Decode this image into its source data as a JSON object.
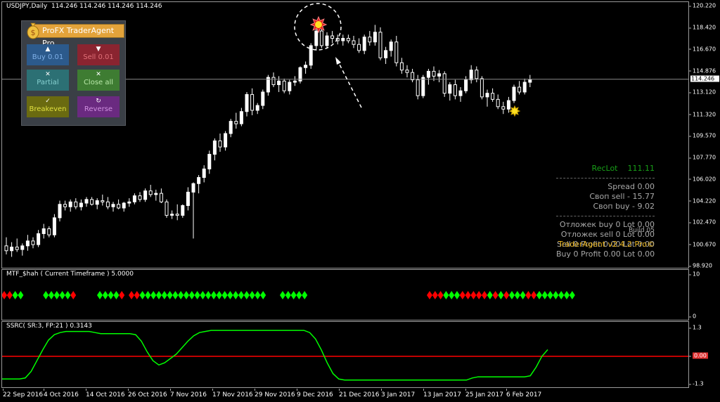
{
  "chart_header": {
    "symbol": "USDJPY,Daily",
    "ohlc": "114.246 114.246 114.246 114.246"
  },
  "price_axis": [
    "120.220",
    "118.420",
    "116.670",
    "114.876",
    "113.120",
    "111.320",
    "109.570",
    "107.770",
    "106.020",
    "104.220",
    "102.470",
    "100.670",
    "98.920"
  ],
  "current_price": "114.246",
  "trade_panel": {
    "title": "ProFX TraderAgent Pro",
    "buttons": {
      "buy": "Buy 0.01",
      "sell": "Sell 0.01",
      "partial": "Partial",
      "close_all": "Close all",
      "breakeven": "Breakeven",
      "reverse": "Reverse"
    },
    "colors": {
      "brand": "#e3a33a",
      "panel": "#3a3f46"
    }
  },
  "info_panel": {
    "reclot_label": "RecLot",
    "reclot_value": "111.11",
    "spread": "Spread   0.00",
    "swap_sell": "Своп sell  - 15.77",
    "swap_buy": "Своп buy  - 9.02",
    "pending_buy": "Отложек buy 0   Lot 0.00",
    "pending_sell": "Отложек sell 0   Lot 0.00",
    "build": "Build 05",
    "version": "TraderAgent v2.4.2 Pro©",
    "sell_summary": "Sell 0  Profit 0.00  Lot 0.00",
    "buy_summary": "Buy 0  Profit 0.00  Lot 0.00"
  },
  "mtf_indicator": {
    "title": "MTF_$hah ( Current Timeframe )  5.0000",
    "scale_top": "10",
    "scale_bottom": "0",
    "colors": {
      "up": "#00ff00",
      "down": "#ff0000"
    }
  },
  "ssrc_indicator": {
    "title": "SSRC( SR:3, FP:21 ) 0.3143",
    "scale_top": "1.3",
    "scale_zero": "0.00",
    "scale_bottom": "-1.3",
    "colors": {
      "line": "#00ff00",
      "zero": "#ff0000"
    }
  },
  "time_axis": [
    "22 Sep 2016",
    "4 Oct 2016",
    "14 Oct 2016",
    "26 Oct 2016",
    "7 Nov 2016",
    "17 Nov 2016",
    "29 Nov 2016",
    "9 Dec 2016",
    "21 Dec 2016",
    "3 Jan 2017",
    "13 Jan 2017",
    "25 Jan 2017",
    "6 Feb 2017"
  ],
  "chart_data": [
    {
      "type": "candlestick",
      "title": "USDJPY,Daily",
      "ylim": [
        98.92,
        120.22
      ],
      "candles": [
        [
          100.6,
          101.3,
          99.9,
          100.2
        ],
        [
          100.2,
          100.9,
          99.7,
          100.5
        ],
        [
          100.5,
          101.2,
          100.1,
          100.3
        ],
        [
          100.3,
          100.8,
          99.8,
          100.6
        ],
        [
          100.6,
          101.5,
          100.2,
          101.0
        ],
        [
          101.0,
          101.3,
          100.4,
          100.7
        ],
        [
          100.7,
          101.9,
          100.5,
          101.6
        ],
        [
          101.6,
          102.4,
          101.2,
          102.0
        ],
        [
          102.0,
          102.2,
          101.3,
          101.5
        ],
        [
          101.5,
          103.2,
          101.3,
          102.9
        ],
        [
          102.9,
          104.3,
          102.6,
          104.0
        ],
        [
          104.0,
          104.3,
          103.5,
          103.8
        ],
        [
          103.8,
          104.4,
          103.4,
          104.2
        ],
        [
          104.2,
          104.5,
          103.6,
          103.8
        ],
        [
          103.8,
          104.4,
          103.5,
          104.1
        ],
        [
          104.1,
          104.6,
          103.8,
          104.4
        ],
        [
          104.4,
          104.6,
          103.9,
          104.0
        ],
        [
          104.0,
          104.5,
          103.6,
          104.3
        ],
        [
          104.3,
          104.8,
          103.9,
          104.2
        ],
        [
          104.2,
          104.6,
          103.6,
          103.8
        ],
        [
          103.8,
          104.2,
          103.4,
          104.0
        ],
        [
          104.0,
          104.4,
          103.6,
          103.7
        ],
        [
          103.7,
          104.2,
          103.4,
          104.1
        ],
        [
          104.1,
          104.5,
          103.8,
          104.2
        ],
        [
          104.2,
          104.9,
          104.0,
          104.7
        ],
        [
          104.7,
          105.0,
          104.2,
          104.4
        ],
        [
          104.4,
          105.3,
          104.2,
          105.1
        ],
        [
          105.1,
          105.6,
          104.6,
          104.8
        ],
        [
          104.8,
          105.2,
          104.3,
          104.9
        ],
        [
          104.9,
          105.3,
          104.1,
          104.2
        ],
        [
          104.2,
          104.4,
          102.9,
          103.1
        ],
        [
          103.1,
          103.5,
          102.8,
          103.2
        ],
        [
          103.2,
          104.0,
          102.7,
          103.1
        ],
        [
          103.1,
          104.0,
          102.9,
          103.9
        ],
        [
          103.9,
          105.4,
          103.5,
          105.0
        ],
        [
          105.0,
          105.8,
          101.2,
          105.7
        ],
        [
          105.7,
          106.4,
          104.9,
          106.2
        ],
        [
          106.2,
          107.2,
          105.8,
          106.9
        ],
        [
          106.9,
          108.4,
          106.5,
          108.1
        ],
        [
          108.1,
          109.4,
          107.6,
          109.2
        ],
        [
          109.2,
          109.8,
          108.3,
          108.7
        ],
        [
          108.7,
          110.0,
          108.4,
          109.8
        ],
        [
          109.8,
          111.0,
          109.5,
          110.8
        ],
        [
          110.8,
          111.5,
          110.2,
          110.6
        ],
        [
          110.6,
          111.9,
          110.4,
          111.6
        ],
        [
          111.6,
          113.2,
          111.2,
          113.0
        ],
        [
          113.0,
          113.5,
          111.3,
          111.7
        ],
        [
          111.7,
          112.3,
          111.4,
          112.1
        ],
        [
          112.1,
          113.4,
          111.8,
          113.2
        ],
        [
          113.2,
          114.6,
          112.9,
          114.4
        ],
        [
          114.4,
          114.8,
          113.6,
          113.8
        ],
        [
          113.8,
          114.5,
          113.2,
          114.1
        ],
        [
          114.1,
          114.3,
          113.1,
          113.3
        ],
        [
          113.3,
          114.2,
          113.0,
          114.0
        ],
        [
          114.0,
          114.5,
          113.7,
          114.1
        ],
        [
          114.1,
          115.3,
          113.9,
          115.2
        ],
        [
          115.2,
          115.7,
          114.7,
          115.4
        ],
        [
          115.4,
          117.2,
          115.1,
          117.0
        ],
        [
          117.0,
          118.7,
          116.6,
          118.2
        ],
        [
          118.2,
          118.4,
          116.8,
          117.0
        ],
        [
          117.0,
          118.1,
          116.8,
          117.8
        ],
        [
          117.8,
          118.2,
          117.2,
          117.6
        ],
        [
          117.6,
          117.9,
          117.1,
          117.4
        ],
        [
          117.4,
          117.9,
          117.0,
          117.6
        ],
        [
          117.6,
          117.9,
          117.2,
          117.4
        ],
        [
          117.4,
          117.8,
          116.8,
          117.1
        ],
        [
          117.1,
          117.6,
          116.4,
          116.6
        ],
        [
          116.6,
          117.9,
          116.3,
          117.7
        ],
        [
          117.7,
          118.2,
          117.0,
          117.3
        ],
        [
          117.3,
          118.7,
          117.0,
          118.1
        ],
        [
          118.1,
          118.5,
          115.8,
          116.0
        ],
        [
          116.0,
          116.9,
          115.5,
          116.6
        ],
        [
          116.6,
          117.5,
          116.1,
          117.3
        ],
        [
          117.3,
          117.8,
          115.3,
          115.6
        ],
        [
          115.6,
          116.0,
          114.7,
          115.0
        ],
        [
          115.0,
          115.4,
          114.4,
          114.8
        ],
        [
          114.8,
          115.1,
          114.0,
          114.2
        ],
        [
          114.2,
          114.6,
          112.6,
          112.9
        ],
        [
          112.9,
          114.6,
          112.7,
          114.4
        ],
        [
          114.4,
          115.1,
          113.8,
          114.9
        ],
        [
          114.9,
          115.3,
          114.1,
          114.5
        ],
        [
          114.5,
          115.0,
          114.0,
          114.7
        ],
        [
          114.7,
          114.9,
          112.8,
          113.1
        ],
        [
          113.1,
          114.0,
          112.5,
          113.8
        ],
        [
          113.8,
          114.2,
          112.6,
          112.9
        ],
        [
          112.9,
          113.6,
          112.4,
          113.3
        ],
        [
          113.3,
          114.5,
          113.1,
          114.2
        ],
        [
          114.2,
          115.4,
          113.9,
          115.0
        ],
        [
          115.0,
          115.3,
          114.0,
          114.3
        ],
        [
          114.3,
          114.5,
          112.6,
          112.8
        ],
        [
          112.8,
          113.4,
          112.0,
          113.1
        ],
        [
          113.1,
          113.5,
          112.4,
          112.6
        ],
        [
          112.6,
          113.0,
          111.8,
          112.0
        ],
        [
          112.0,
          112.4,
          111.4,
          111.8
        ],
        [
          111.8,
          112.8,
          111.5,
          112.5
        ],
        [
          112.5,
          113.8,
          112.3,
          113.6
        ],
        [
          113.6,
          114.1,
          113.0,
          113.2
        ],
        [
          113.2,
          114.3,
          113.0,
          114.0
        ],
        [
          114.0,
          114.6,
          113.6,
          114.2
        ]
      ],
      "current_price": 114.246
    },
    {
      "type": "scatter",
      "title": "MTF_$hah ( Current Timeframe )  5.0000",
      "ylim": [
        0,
        10
      ],
      "signals": [
        "down",
        "down",
        "up",
        "up",
        "up",
        "up",
        "up",
        "up",
        "up",
        "down",
        "up",
        "up",
        "up",
        "up",
        "down",
        "down",
        "down",
        "up",
        "up",
        "up",
        "up",
        "up",
        "up",
        "up",
        "up",
        "up",
        "up",
        "up",
        "up",
        "up",
        "up",
        "up",
        "up",
        "up",
        "up",
        "up",
        "up",
        "up",
        "up",
        "up",
        "up",
        "up",
        "up",
        "up",
        "up",
        "down",
        "down",
        "down",
        "up",
        "up",
        "up",
        "down",
        "down",
        "down",
        "down",
        "down",
        "up",
        "down",
        "up",
        "down",
        "up",
        "up",
        "up",
        "down",
        "down",
        "up",
        "up",
        "up",
        "up",
        "up",
        "up",
        "up"
      ]
    },
    {
      "type": "line",
      "title": "SSRC( SR:3, FP:21 ) 0.3143",
      "ylim": [
        -1.3,
        1.3
      ],
      "values": [
        -1.05,
        -1.05,
        -1.05,
        -1.05,
        -1.0,
        -0.7,
        -0.2,
        0.3,
        0.75,
        1.0,
        1.1,
        1.15,
        1.15,
        1.15,
        1.15,
        1.15,
        1.1,
        1.05,
        1.05,
        1.05,
        1.05,
        1.05,
        1.05,
        1.0,
        0.7,
        0.2,
        -0.2,
        -0.4,
        -0.3,
        -0.1,
        0.1,
        0.4,
        0.7,
        0.95,
        1.1,
        1.15,
        1.2,
        1.2,
        1.2,
        1.2,
        1.2,
        1.2,
        1.2,
        1.2,
        1.2,
        1.2,
        1.2,
        1.2,
        1.2,
        1.2,
        1.2,
        1.2,
        1.2,
        1.1,
        0.8,
        0.3,
        -0.3,
        -0.8,
        -1.05,
        -1.1,
        -1.1,
        -1.1,
        -1.1,
        -1.1,
        -1.1,
        -1.1,
        -1.1,
        -1.1,
        -1.1,
        -1.1,
        -1.1,
        -1.1,
        -1.1,
        -1.1,
        -1.1,
        -1.1,
        -1.1,
        -1.1,
        -1.1,
        -1.1,
        -1.1,
        -1.0,
        -0.95,
        -0.95,
        -0.95,
        -0.95,
        -0.95,
        -0.95,
        -0.95,
        -0.95,
        -0.95,
        -0.9,
        -0.5,
        0.0,
        0.31
      ]
    }
  ]
}
